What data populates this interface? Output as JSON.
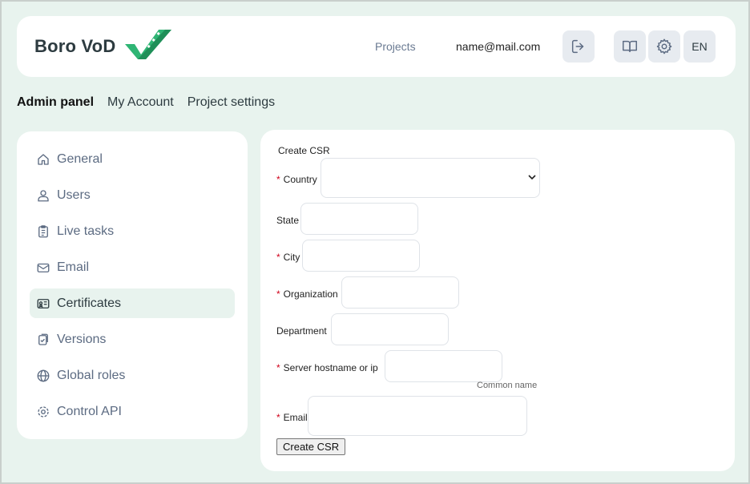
{
  "header": {
    "logo_text": "Boro VoD",
    "nav_projects": "Projects",
    "user_email": "name@mail.com",
    "lang": "EN"
  },
  "topnav": [
    "Admin panel",
    "My Account",
    "Project settings"
  ],
  "sidebar": {
    "items": [
      {
        "label": "General",
        "icon": "home-icon"
      },
      {
        "label": "Users",
        "icon": "user-icon"
      },
      {
        "label": "Live tasks",
        "icon": "clipboard-icon"
      },
      {
        "label": "Email",
        "icon": "mail-icon"
      },
      {
        "label": "Certificates",
        "icon": "certificate-icon",
        "active": true
      },
      {
        "label": "Versions",
        "icon": "versions-icon"
      },
      {
        "label": "Global roles",
        "icon": "globe-icon"
      },
      {
        "label": "Control API",
        "icon": "gear-icon"
      }
    ]
  },
  "form": {
    "title": "Create CSR",
    "country_label": "Country",
    "country_value": "",
    "state_label": "State",
    "city_label": "City",
    "organization_label": "Organization",
    "department_label": "Department",
    "hostname_label": "Server hostname or ip",
    "hostname_hint": "Common name",
    "email_label": "Email",
    "submit_label": "Create CSR"
  },
  "colors": {
    "page_bg": "#e8f3ee",
    "logo_green": "#2fb574",
    "required": "#d0021b",
    "nav_link": "#6a7a92"
  }
}
